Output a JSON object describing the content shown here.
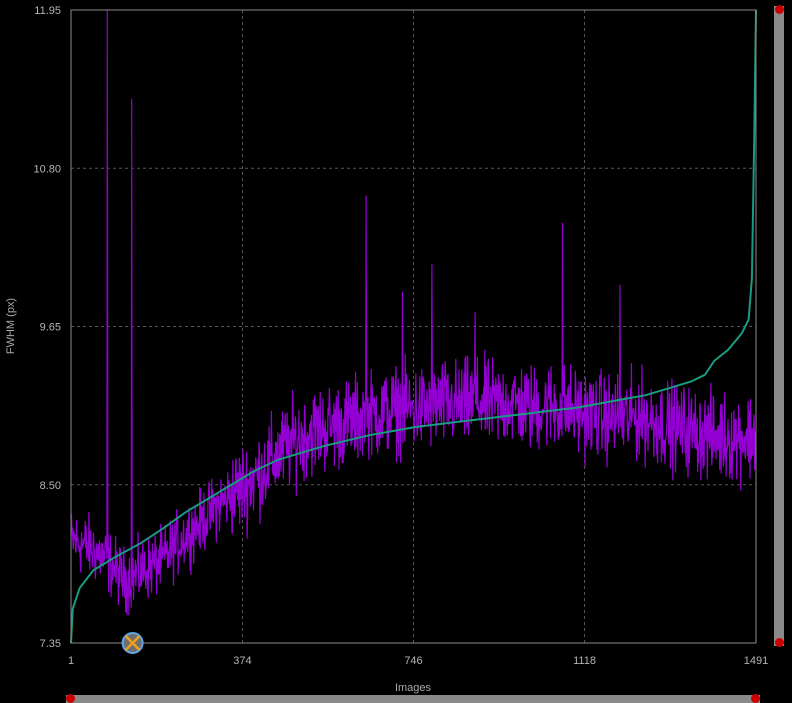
{
  "chart_data": {
    "type": "line",
    "title": "",
    "xlabel": "Images",
    "ylabel": "FWHM (px)",
    "xlim": [
      1,
      1491
    ],
    "ylim": [
      7.35,
      11.95
    ],
    "x_ticks": [
      "1",
      "374",
      "746",
      "1118",
      "1491"
    ],
    "x_tick_values": [
      1,
      374,
      746,
      1118,
      1491
    ],
    "y_ticks": [
      "7.35",
      "8.50",
      "9.65",
      "10.80",
      "11.95"
    ],
    "y_tick_values": [
      7.35,
      8.5,
      9.65,
      10.8,
      11.95
    ],
    "grid": true,
    "series": [
      {
        "color": "#9400d3",
        "x": [
          1,
          40,
          80,
          120,
          160,
          200,
          240,
          280,
          320,
          360,
          400,
          440,
          480,
          520,
          560,
          600,
          640,
          680,
          720,
          760,
          800,
          840,
          880,
          920,
          960,
          1000,
          1040,
          1080,
          1120,
          1160,
          1200,
          1240,
          1280,
          1320,
          1360,
          1400,
          1440,
          1491
        ],
        "y": [
          8.1,
          8.05,
          7.95,
          7.8,
          7.88,
          7.95,
          8.1,
          8.22,
          8.35,
          8.45,
          8.55,
          8.68,
          8.8,
          8.88,
          8.92,
          8.95,
          9.0,
          9.02,
          9.05,
          9.05,
          9.08,
          9.08,
          9.1,
          9.08,
          9.1,
          9.05,
          9.08,
          9.05,
          9.02,
          9.0,
          8.98,
          9.0,
          8.95,
          8.92,
          8.88,
          8.85,
          8.85,
          8.85
        ],
        "spikes": [
          {
            "x": 80,
            "y": 11.95
          },
          {
            "x": 133,
            "y": 11.3
          },
          {
            "x": 643,
            "y": 10.6
          },
          {
            "x": 1070,
            "y": 10.4
          },
          {
            "x": 786,
            "y": 10.1
          },
          {
            "x": 1195,
            "y": 9.95
          },
          {
            "x": 722,
            "y": 9.9
          },
          {
            "x": 880,
            "y": 9.75
          }
        ]
      },
      {
        "color": "#1a9a80",
        "x": [
          1,
          5,
          20,
          50,
          100,
          150,
          200,
          250,
          300,
          350,
          400,
          450,
          500,
          550,
          600,
          650,
          700,
          750,
          800,
          850,
          900,
          950,
          1000,
          1050,
          1100,
          1150,
          1200,
          1250,
          1300,
          1350,
          1380,
          1400,
          1430,
          1460,
          1475,
          1482,
          1487,
          1491
        ],
        "y": [
          7.35,
          7.6,
          7.75,
          7.88,
          7.98,
          8.07,
          8.18,
          8.3,
          8.4,
          8.5,
          8.6,
          8.68,
          8.73,
          8.78,
          8.82,
          8.86,
          8.89,
          8.92,
          8.94,
          8.96,
          8.98,
          9.0,
          9.02,
          9.04,
          9.06,
          9.09,
          9.12,
          9.15,
          9.2,
          9.25,
          9.3,
          9.4,
          9.48,
          9.6,
          9.7,
          10.0,
          11.0,
          11.95
        ]
      }
    ],
    "marker": {
      "x": 135,
      "y": 7.35,
      "icon": "crossed-circle-icon"
    }
  }
}
